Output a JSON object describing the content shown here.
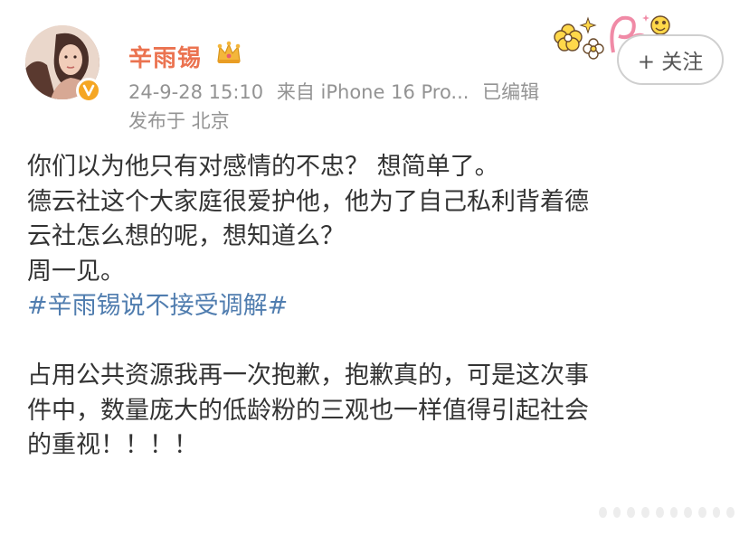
{
  "user": {
    "name": "辛雨锡",
    "timestamp": "24-9-28 15:10",
    "source": "来自 iPhone 16 Pro...",
    "edited": "已编辑",
    "location": "发布于 北京",
    "follow_label": "+ 关注"
  },
  "post": {
    "lines": [
      "你们以为他只有对感情的不忠？ 想简单了。",
      "德云社这个大家庭很爱护他，他为了自己私利背着德",
      "云社怎么想的呢，想知道么？",
      "周一见。"
    ],
    "hashtag": "#辛雨锡说不接受调解#",
    "lines2": [
      "占用公共资源我再一次抱歉，抱歉真的，可是这次事",
      "件中，数量庞大的低龄粉的三观也一样值得引起社会",
      "的重视！！！！"
    ]
  },
  "colors": {
    "username": "#eb7350",
    "meta": "#939393",
    "hashtag": "#507daf",
    "badge": "#f5a623"
  },
  "icons": [
    "crown-icon",
    "verified-badge-icon",
    "sticker-decoration",
    "more-dots-icon"
  ]
}
